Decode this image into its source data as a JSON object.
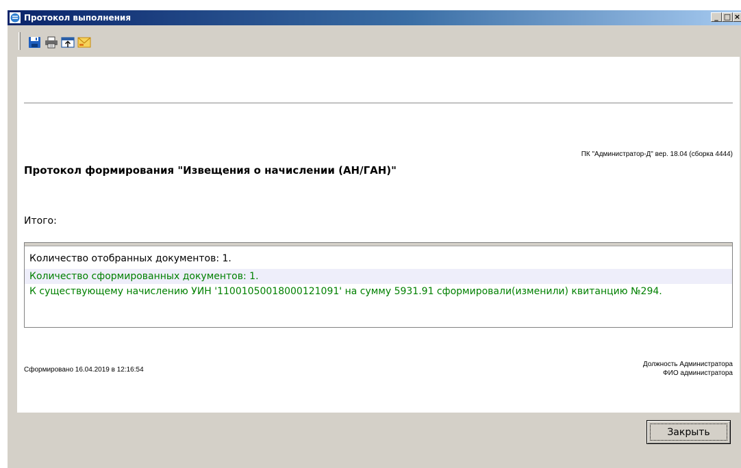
{
  "window": {
    "title": "Протокол выполнения",
    "controls": {
      "minimize": "_",
      "maximize": "□",
      "close": "×"
    }
  },
  "toolbar": {
    "icons": [
      "save-icon",
      "print-icon",
      "export-icon",
      "email-icon"
    ]
  },
  "report": {
    "version": "ПК \"Администратор-Д\" вер. 18.04 (сборка 4444)",
    "title": "Протокол формирования \"Извещения о начислении (АН/ГАН)\"",
    "total_label": "Итого:",
    "results": [
      "Количество отобранных документов:  1.",
      "Количество сформированных документов:  1.",
      "К существующему начислению УИН '11001050018000121091' на сумму 5931.91 сформировали(изменили) квитанцию №294."
    ],
    "generated": "Сформировано 16.04.2019 в 12:16:54",
    "position": "Должность Администратора",
    "fio": "ФИО администратора"
  },
  "buttons": {
    "close": "Закрыть"
  },
  "colors": {
    "titlebar_start": "#0a246a",
    "titlebar_end": "#a6caf0",
    "result_ok": "#008000",
    "window_bg": "#d4d0c8"
  }
}
